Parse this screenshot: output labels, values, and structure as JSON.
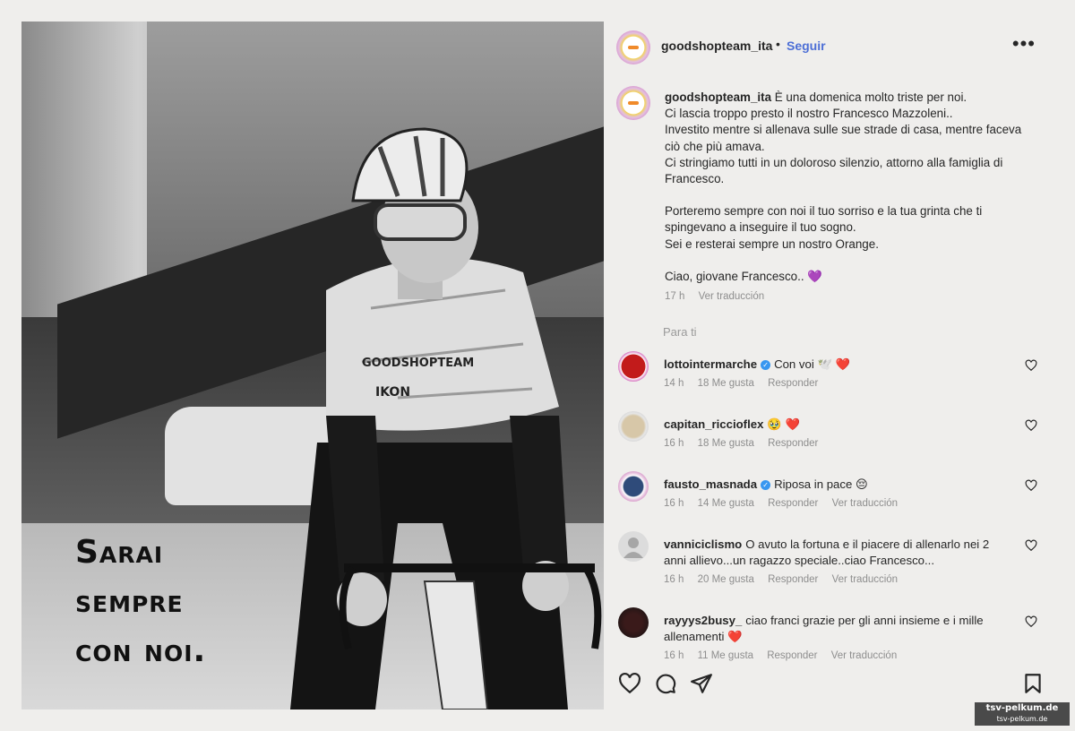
{
  "slogan": [
    "Sarai",
    "sempre",
    "con noi."
  ],
  "header": {
    "username": "goodshopteam_ita",
    "separator": "•",
    "follow_label": "Seguir",
    "more_icon": "more-horizontal-icon"
  },
  "caption": {
    "username": "goodshopteam_ita",
    "paragraphs": [
      [
        "È una domenica molto triste per noi.",
        "Ci lascia troppo presto il nostro Francesco Mazzoleni..",
        "Investito mentre si allenava sulle sue strade di casa, mentre faceva ciò che più amava.",
        "Ci stringiamo tutti in un doloroso silenzio, attorno alla famiglia di Francesco."
      ],
      [
        "Porteremo sempre con noi il tuo sorriso e la tua grinta che ti spingevano a inseguire il tuo sogno.",
        "Sei e resterai sempre un nostro Orange."
      ],
      [
        "Ciao, giovane Francesco.. 💜"
      ]
    ],
    "time": "17 h",
    "translation": "Ver traducción"
  },
  "para_ti": "Para ti",
  "comments": [
    {
      "username": "lottointermarche",
      "verified": true,
      "text": "Con voi 🕊️ ❤️",
      "time": "14 h",
      "likes": "18 Me gusta",
      "reply": "Responder",
      "translation": ""
    },
    {
      "username": "capitan_riccioflex",
      "verified": false,
      "text": "🥹 ❤️",
      "time": "16 h",
      "likes": "18 Me gusta",
      "reply": "Responder",
      "translation": ""
    },
    {
      "username": "fausto_masnada",
      "verified": true,
      "text": "Riposa in pace 😔",
      "time": "16 h",
      "likes": "14 Me gusta",
      "reply": "Responder",
      "translation": "Ver traducción"
    },
    {
      "username": "vanniciclismo",
      "verified": false,
      "text": "O avuto la fortuna e il piacere di allenarlo nei 2 anni allievo...un ragazzo speciale..ciao Francesco...",
      "time": "16 h",
      "likes": "20 Me gusta",
      "reply": "Responder",
      "translation": "Ver traducción"
    },
    {
      "username": "rayyys2busy_",
      "verified": false,
      "text": "ciao franci grazie per gli anni insieme e i mille allenamenti ❤️",
      "time": "16 h",
      "likes": "11 Me gusta",
      "reply": "Responder",
      "translation": "Ver traducción"
    }
  ],
  "actions": [
    "heart-icon",
    "comment-icon",
    "share-icon",
    "bookmark-icon"
  ],
  "watermark": {
    "line1": "tsv-pelkum.de",
    "line2": "tsv-pelkum.de"
  },
  "colors": {
    "link": "#4d6fd6",
    "verified": "#3897f0",
    "heart": "#e0245e",
    "meta": "#8e8e8e"
  }
}
